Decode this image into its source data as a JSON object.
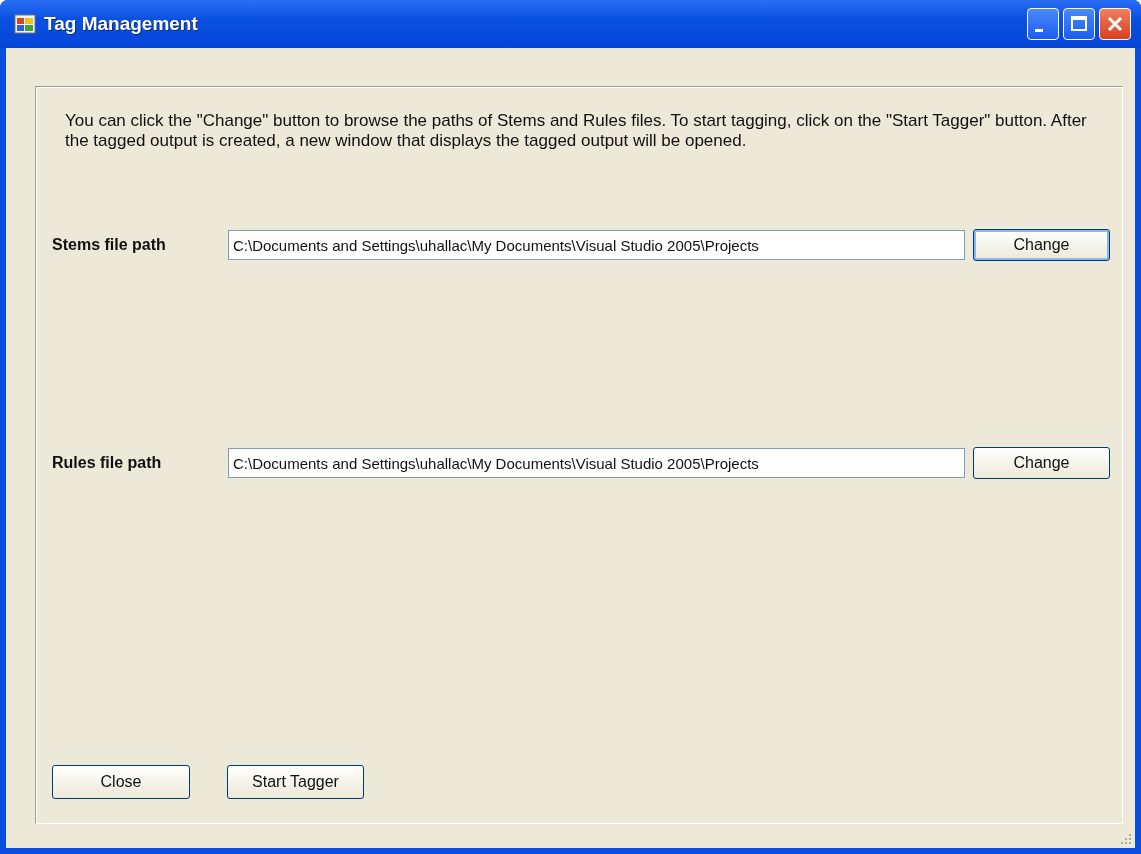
{
  "window": {
    "title": "Tag Management"
  },
  "description": "You can click the \"Change\" button to browse the paths of Stems and Rules files. To start tagging, click on the \"Start Tagger\" button. After the tagged output is created, a new window that displays the tagged output will be opened.",
  "paths": [
    {
      "label": "Stems file path",
      "value": "C:\\Documents and Settings\\uhallac\\My Documents\\Visual Studio 2005\\Projects",
      "button": "Change",
      "focused": true
    },
    {
      "label": "Rules file path",
      "value": "C:\\Documents and Settings\\uhallac\\My Documents\\Visual Studio 2005\\Projects",
      "button": "Change",
      "focused": false
    }
  ],
  "buttons": [
    "Close",
    "Start Tagger"
  ]
}
